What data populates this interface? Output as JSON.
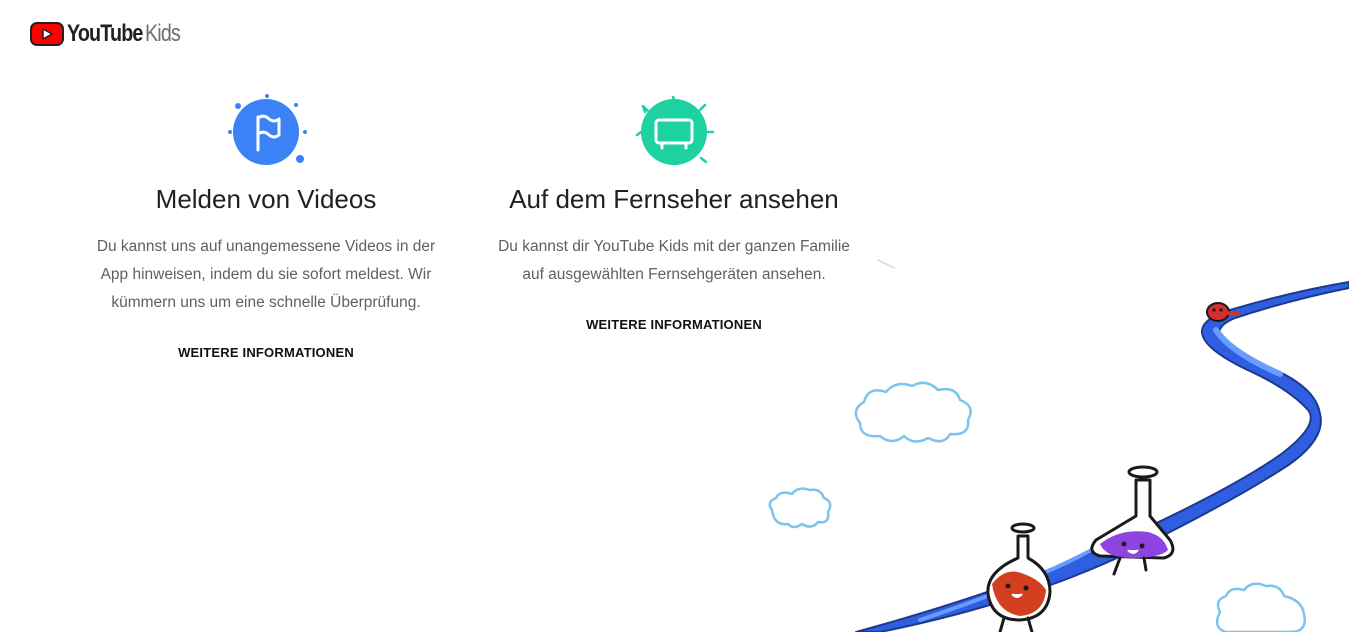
{
  "brand": {
    "youtube": "YouTube",
    "kids": "Kids",
    "red": "#ff0000"
  },
  "features": [
    {
      "icon": "flag-icon",
      "color": "#3b82f6",
      "title": "Melden von Videos",
      "description": "Du kannst uns auf unangemessene Videos in der App hinweisen, indem du sie sofort meldest. Wir kümmern uns um eine schnelle Überprüfung.",
      "link": "WEITERE INFORMATIONEN"
    },
    {
      "icon": "tv-icon",
      "color": "#1dd1a1",
      "title": "Auf dem Fernseher ansehen",
      "description": "Du kannst dir YouTube Kids mit der ganzen Familie auf ausgewählten Fernsehgeräten ansehen.",
      "link": "WEITERE INFORMATIONEN"
    }
  ]
}
